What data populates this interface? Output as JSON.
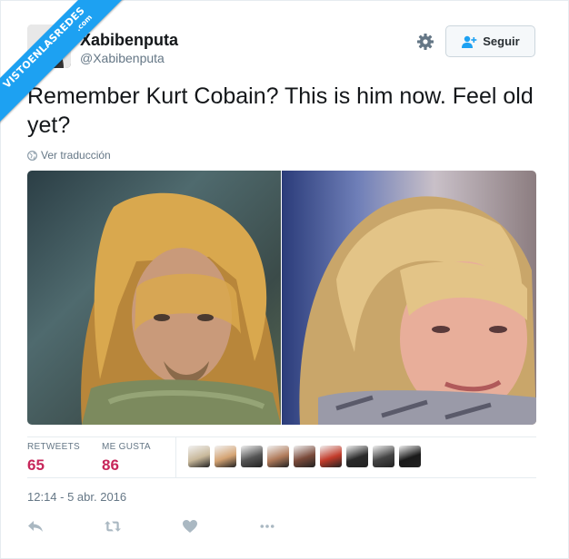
{
  "watermark": {
    "text": "VISTOENLASREDES",
    "suffix": ".com",
    "color": "#1da1f2"
  },
  "tweet": {
    "author": {
      "name": "Xabibenputa",
      "handle": "@Xabibenputa",
      "avatar_icon": "avatar-portrait-icon"
    },
    "settings_icon": "gear-icon",
    "follow": {
      "label": "Seguir",
      "icon": "add-user-icon"
    },
    "text": "Remember Kurt Cobain? This is him now. Feel old yet?",
    "translate": {
      "icon": "globe-icon",
      "label": "Ver traducción"
    },
    "media": [
      {
        "kind": "photo"
      },
      {
        "kind": "photo"
      }
    ],
    "stats": {
      "retweets_label": "RETWEETS",
      "retweets_value": "65",
      "likes_label": "ME GUSTA",
      "likes_value": "86",
      "value_color": "#c7265a"
    },
    "liker_avatars": [
      {
        "color": "#c8b89a"
      },
      {
        "color": "#d4a373"
      },
      {
        "color": "#555555"
      },
      {
        "color": "#b07a5a"
      },
      {
        "color": "#7a4a3a"
      },
      {
        "color": "#c23b2a"
      },
      {
        "color": "#2a2a2a"
      },
      {
        "color": "#444444"
      },
      {
        "color": "#1a1a1a"
      }
    ],
    "timestamp": "12:14 - 5 abr. 2016",
    "actions": [
      {
        "name": "reply",
        "icon": "reply-icon"
      },
      {
        "name": "retweet",
        "icon": "retweet-icon"
      },
      {
        "name": "like",
        "icon": "heart-icon"
      },
      {
        "name": "more",
        "icon": "more-icon"
      }
    ]
  }
}
